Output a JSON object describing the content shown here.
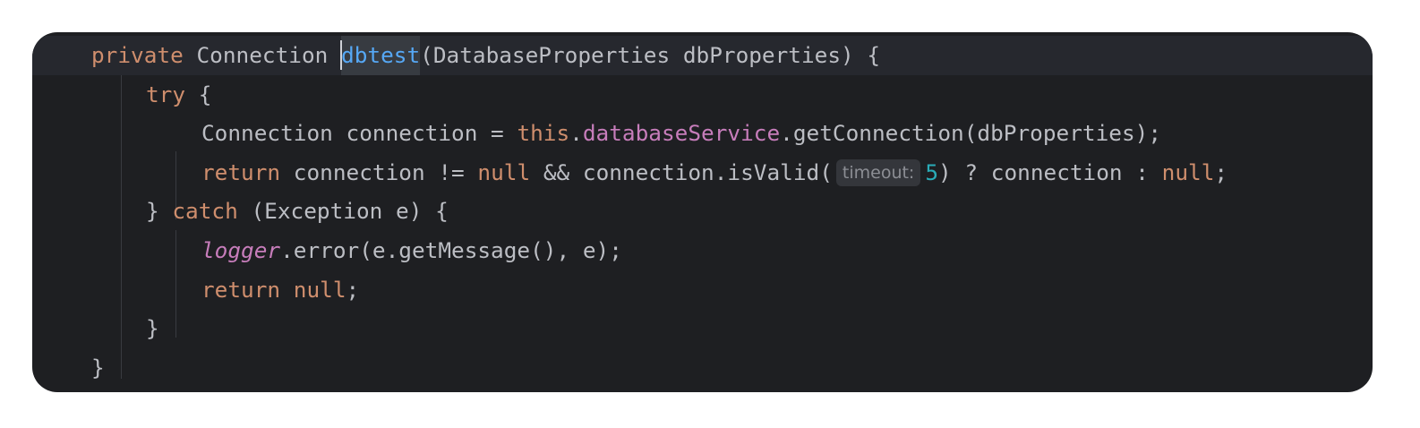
{
  "editor": {
    "theme": {
      "background": "#1e1f22",
      "current_line": "#26282e",
      "text": "#bcbec4",
      "keyword": "#cf8e6d",
      "field": "#c77dbb",
      "number": "#2aacb8",
      "method_declaration": "#56a8f5",
      "inlay_hint_bg": "#34363b"
    },
    "tokens": {
      "private": "private",
      "connection_type": "Connection",
      "method_name": "dbtest",
      "sig_rest": "(DatabaseProperties dbProperties) {",
      "try_kw": "try",
      "open_brace": " {",
      "l3_decl": "Connection connection = ",
      "this_kw": "this",
      "dot": ".",
      "field_name": "databaseService",
      "l3_rest": ".getConnection(dbProperties);",
      "return_kw": "return",
      "l4_a": " connection != ",
      "null_kw": "null",
      "l4_b": " && connection.isValid(",
      "hint_label": "timeout:",
      "timeout_value": "5",
      "l4_c": ") ? connection : ",
      "semicolon": ";",
      "close_brace": "}",
      "catch_kw": "catch",
      "catch_rest": " (Exception e) {",
      "logger_field": "logger",
      "l6_rest": ".error(e.getMessage(), e);",
      "space": " "
    }
  }
}
